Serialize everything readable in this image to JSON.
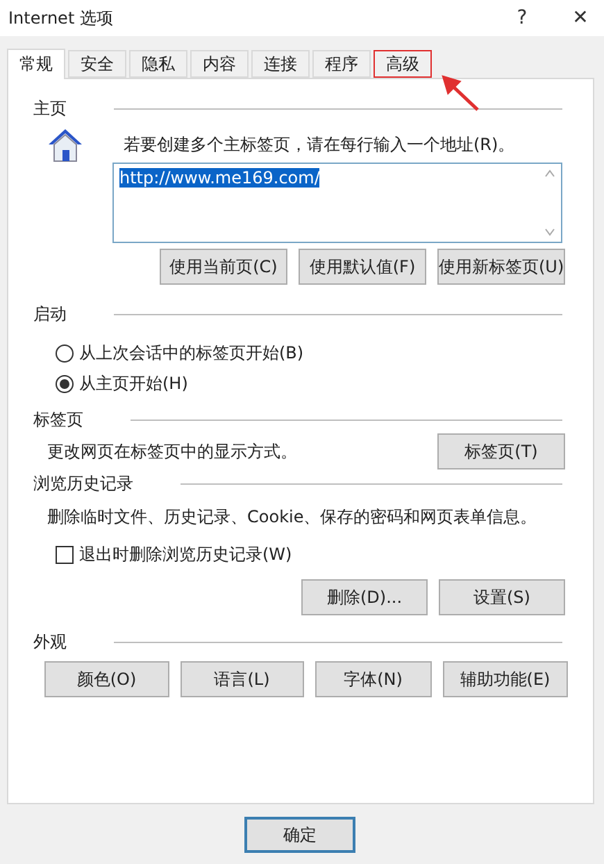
{
  "window": {
    "title": "Internet 选项",
    "help": "?",
    "close": "✕"
  },
  "tabs": [
    {
      "label": "常规",
      "selected": true,
      "highlighted": false
    },
    {
      "label": "安全",
      "selected": false,
      "highlighted": false
    },
    {
      "label": "隐私",
      "selected": false,
      "highlighted": false
    },
    {
      "label": "内容",
      "selected": false,
      "highlighted": false
    },
    {
      "label": "连接",
      "selected": false,
      "highlighted": false
    },
    {
      "label": "程序",
      "selected": false,
      "highlighted": false
    },
    {
      "label": "高级",
      "selected": false,
      "highlighted": true
    }
  ],
  "home": {
    "title": "主页",
    "hint": "若要创建多个主标签页，请在每行输入一个地址(R)。",
    "value": "http://www.me169.com/",
    "buttons": [
      "使用当前页(C)",
      "使用默认值(F)",
      "使用新标签页(U)"
    ]
  },
  "startup": {
    "title": "启动",
    "options": [
      {
        "label": "从上次会话中的标签页开始(B)",
        "selected": false
      },
      {
        "label": "从主页开始(H)",
        "selected": true
      }
    ]
  },
  "tabs_section": {
    "title": "标签页",
    "text": "更改网页在标签页中的显示方式。",
    "button": "标签页(T)"
  },
  "history": {
    "title": "浏览历史记录",
    "text": "删除临时文件、历史记录、Cookie、保存的密码和网页表单信息。",
    "checkbox": {
      "label": "退出时删除浏览历史记录(W)",
      "checked": false
    },
    "buttons": [
      "删除(D)...",
      "设置(S)"
    ]
  },
  "appearance": {
    "title": "外观",
    "buttons": [
      "颜色(O)",
      "语言(L)",
      "字体(N)",
      "辅助功能(E)"
    ]
  },
  "footer": {
    "buttons": [
      "确定"
    ]
  }
}
